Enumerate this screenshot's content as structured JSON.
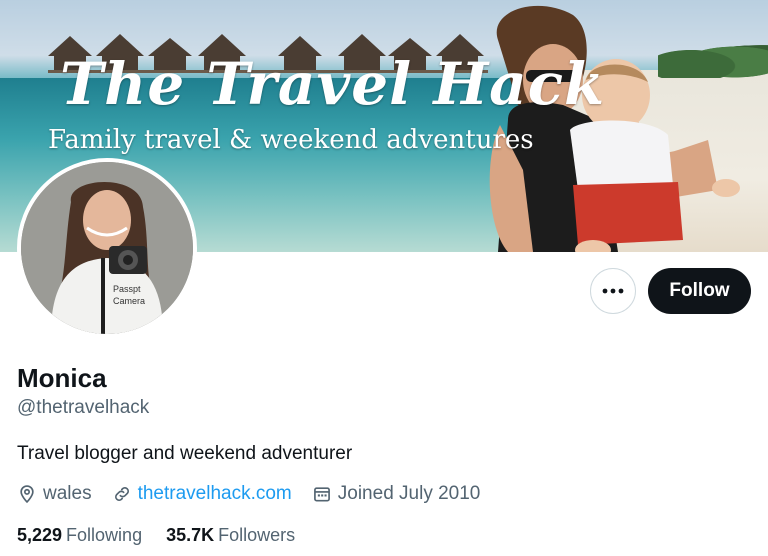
{
  "banner": {
    "title": "The Travel Hack",
    "subtitle": "Family travel & weekend adventures"
  },
  "actions": {
    "more_icon": "more-horizontal-icon",
    "follow_label": "Follow"
  },
  "profile": {
    "name": "Monica",
    "handle": "@thetravelhack",
    "bio": "Travel blogger and weekend adventurer",
    "location": "wales",
    "website": "thetravelhack.com",
    "joined": "Joined July 2010"
  },
  "stats": {
    "following_count": "5,229",
    "following_label": "Following",
    "followers_count": "35.7K",
    "followers_label": "Followers"
  },
  "colors": {
    "accent": "#1d9bf0",
    "text": "#0f1419",
    "secondary_text": "#536471",
    "follow_bg": "#0f1419"
  }
}
